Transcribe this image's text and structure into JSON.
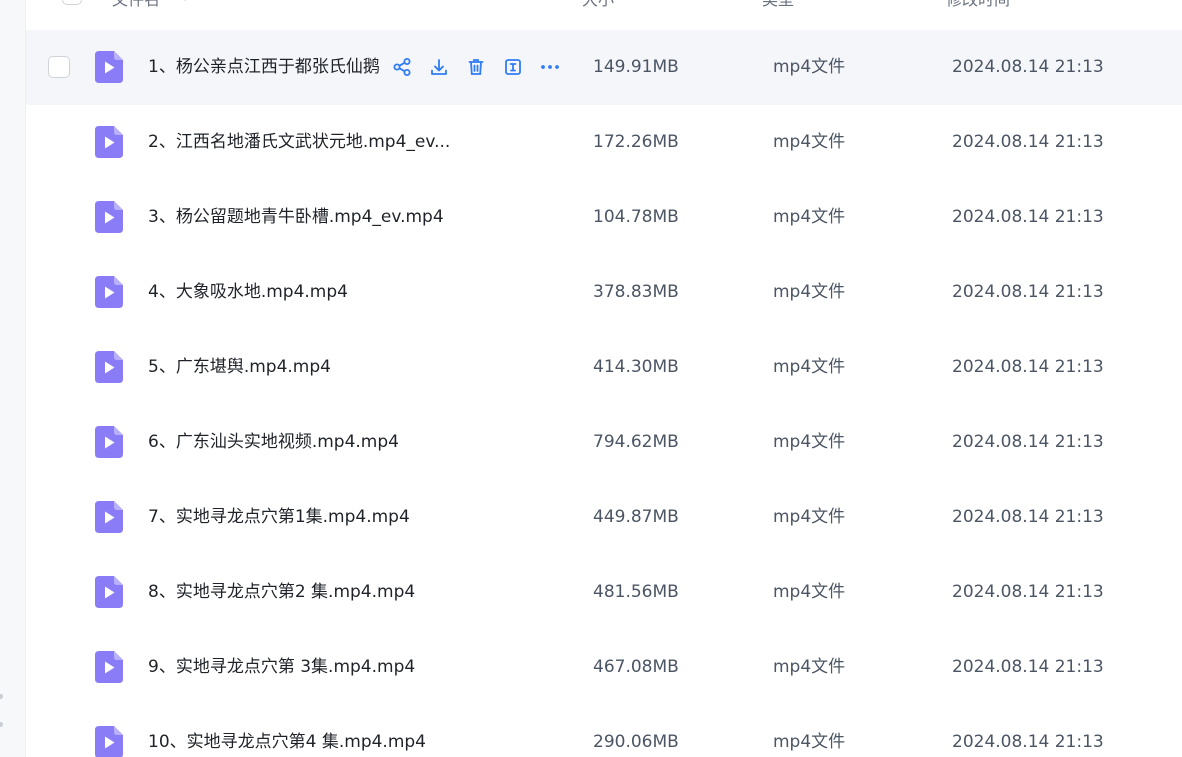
{
  "colors": {
    "accent": "#2f7cf6",
    "file_icon": "#8a7cf6",
    "hover_row": "#f5f6fa"
  },
  "header": {
    "name": "文件名",
    "size": "大小",
    "type": "类型",
    "modified": "修改时间"
  },
  "actions": [
    {
      "name": "share-icon"
    },
    {
      "name": "download-icon"
    },
    {
      "name": "delete-icon"
    },
    {
      "name": "rename-icon"
    },
    {
      "name": "more-icon"
    }
  ],
  "files": [
    {
      "name": "1、杨公亲点江西于都张氏仙鹅",
      "size": "149.91MB",
      "type": "mp4文件",
      "time": "2024.08.14 21:13"
    },
    {
      "name": "2、江西名地潘氏文武状元地.mp4_ev...",
      "size": "172.26MB",
      "type": "mp4文件",
      "time": "2024.08.14 21:13"
    },
    {
      "name": "3、杨公留题地青牛卧槽.mp4_ev.mp4",
      "size": "104.78MB",
      "type": "mp4文件",
      "time": "2024.08.14 21:13"
    },
    {
      "name": "4、大象吸水地.mp4.mp4",
      "size": "378.83MB",
      "type": "mp4文件",
      "time": "2024.08.14 21:13"
    },
    {
      "name": "5、广东堪舆.mp4.mp4",
      "size": "414.30MB",
      "type": "mp4文件",
      "time": "2024.08.14 21:13"
    },
    {
      "name": "6、广东汕头实地视频.mp4.mp4",
      "size": "794.62MB",
      "type": "mp4文件",
      "time": "2024.08.14 21:13"
    },
    {
      "name": "7、实地寻龙点穴第1集.mp4.mp4",
      "size": "449.87MB",
      "type": "mp4文件",
      "time": "2024.08.14 21:13"
    },
    {
      "name": "8、实地寻龙点穴第2 集.mp4.mp4",
      "size": "481.56MB",
      "type": "mp4文件",
      "time": "2024.08.14 21:13"
    },
    {
      "name": "9、实地寻龙点穴第 3集.mp4.mp4",
      "size": "467.08MB",
      "type": "mp4文件",
      "time": "2024.08.14 21:13"
    },
    {
      "name": "10、实地寻龙点穴第4 集.mp4.mp4",
      "size": "290.06MB",
      "type": "mp4文件",
      "time": "2024.08.14 21:13"
    }
  ]
}
